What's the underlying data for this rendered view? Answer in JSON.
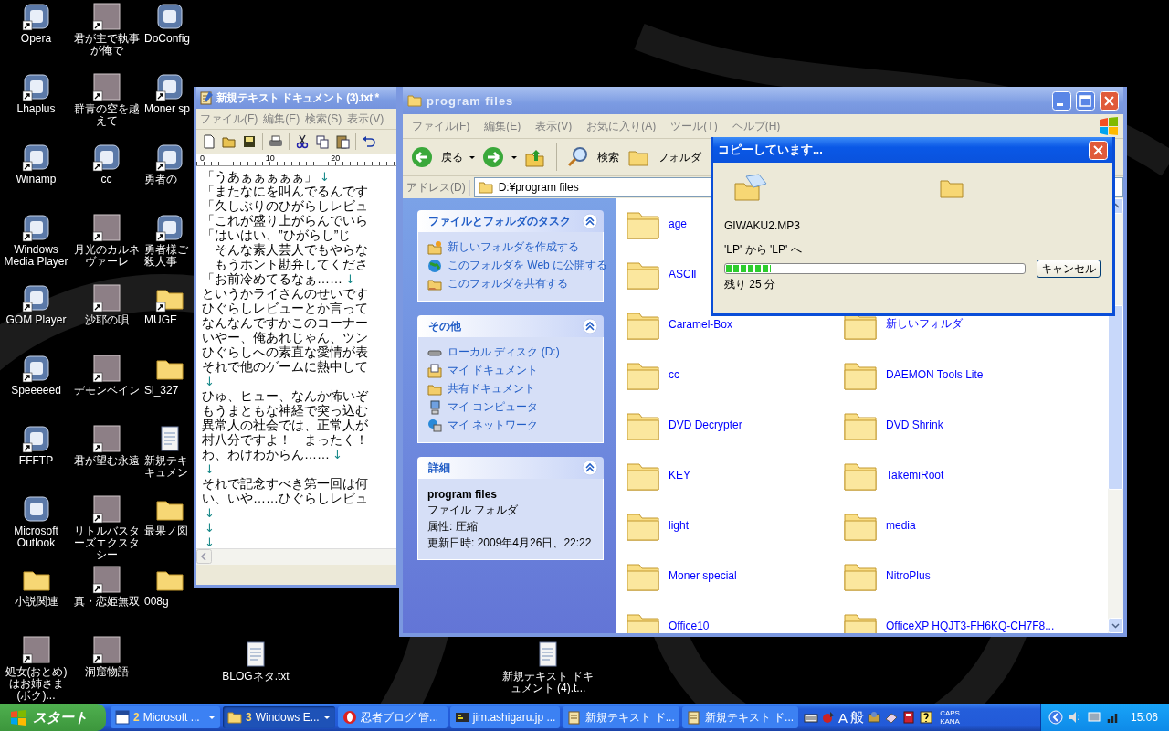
{
  "desktop_icons": [
    {
      "label": "Opera",
      "kind": "app",
      "shortcut": true
    },
    {
      "label": "Lhaplus",
      "kind": "app",
      "shortcut": true
    },
    {
      "label": "Winamp",
      "kind": "app",
      "shortcut": true
    },
    {
      "label": "Windows\nMedia Player",
      "kind": "app",
      "shortcut": true
    },
    {
      "label": "GOM Player",
      "kind": "app",
      "shortcut": true
    },
    {
      "label": "Speeeeed",
      "kind": "app",
      "shortcut": true
    },
    {
      "label": "FFFTP",
      "kind": "app",
      "shortcut": true
    },
    {
      "label": "Microsoft\nOutlook",
      "kind": "app",
      "shortcut": false
    },
    {
      "label": "小説関連",
      "kind": "folder",
      "shortcut": false
    },
    {
      "label": "処女(おとめ)はお姉さま(ボク)...",
      "kind": "picture",
      "shortcut": true
    },
    {
      "label": "君が主で執事が俺で",
      "kind": "picture",
      "shortcut": true
    },
    {
      "label": "群青の空を越えて",
      "kind": "picture",
      "shortcut": true
    },
    {
      "label": "cc",
      "kind": "app",
      "shortcut": true
    },
    {
      "label": "月光のカルネヴァーレ",
      "kind": "picture",
      "shortcut": true
    },
    {
      "label": "沙耶の唄",
      "kind": "picture",
      "shortcut": true
    },
    {
      "label": "デモンベイン",
      "kind": "picture",
      "shortcut": true
    },
    {
      "label": "君が望む永遠",
      "kind": "picture",
      "shortcut": true
    },
    {
      "label": "リトルバスターズエクスタシー",
      "kind": "picture",
      "shortcut": true
    },
    {
      "label": "真・恋姫無双",
      "kind": "picture",
      "shortcut": true
    },
    {
      "label": "洞窟物語",
      "kind": "picture",
      "shortcut": true
    },
    {
      "label": "DoConfig",
      "kind": "app",
      "shortcut": false
    },
    {
      "label": "Moner sp",
      "kind": "app",
      "shortcut": true
    },
    {
      "label": "勇者の",
      "kind": "app",
      "shortcut": true
    },
    {
      "label": "勇者様ご殺人事",
      "kind": "app",
      "shortcut": true
    },
    {
      "label": "MUGE",
      "kind": "folder",
      "shortcut": true
    },
    {
      "label": "Si_327",
      "kind": "folder",
      "shortcut": false
    },
    {
      "label": "新規テキキュメン",
      "kind": "document",
      "shortcut": false
    },
    {
      "label": "最果ノ図",
      "kind": "folder",
      "shortcut": false
    },
    {
      "label": "008g",
      "kind": "folder",
      "shortcut": false
    }
  ],
  "loose_icons": [
    {
      "label": "BLOGネタ.txt",
      "kind": "document",
      "shortcut": false
    },
    {
      "label": "新規テキスト ドキュメント (4).t...",
      "kind": "document",
      "shortcut": false
    }
  ],
  "notepad": {
    "title": "新規テキスト ドキュメント (3).txt *",
    "menu": [
      "ファイル(F)",
      "編集(E)",
      "検索(S)",
      "表示(V)"
    ],
    "ruler": [
      "0",
      "10",
      "20"
    ],
    "lines": [
      {
        "text": "「うあぁぁぁぁぁ」",
        "eol": "↓"
      },
      {
        "text": "「またなにを叫んでるんです"
      },
      {
        "text": "「久しぶりのひがらしレビュ"
      },
      {
        "text": "「これが盛り上がらんでいら"
      },
      {
        "text": "「はいはい、”ひがらし”じ"
      },
      {
        "text": "　そんな素人芸人でもやらな"
      },
      {
        "text": "　もうホント勘弁してくださ"
      },
      {
        "text": "「お前冷めてるなぁ……",
        "eol": "↓"
      },
      {
        "text": "というかライさんのせいです"
      },
      {
        "text": "ひぐらしレビューとか言って"
      },
      {
        "text": "なんなんですかこのコーナー"
      },
      {
        "text": "いやー、俺あれじゃん、ツン"
      },
      {
        "text": "ひぐらしへの素直な愛情が表"
      },
      {
        "text": "それで他のゲームに熱中して"
      },
      {
        "eol": "↓"
      },
      {
        "text": "ひゅ、ヒュー、なんか怖いぞ"
      },
      {
        "text": "もうまともな神経で突っ込む"
      },
      {
        "text": "異常人の社会では、正常人が"
      },
      {
        "text": "村八分ですよ！　まったく！"
      },
      {
        "text": "わ、わけわからん……",
        "eol": "↓"
      },
      {
        "eol": "↓"
      },
      {
        "text": "それで記念すべき第一回は何"
      },
      {
        "text": "い、いや……ひぐらしレビュ"
      },
      {
        "eol": "↓"
      },
      {
        "eol": "↓"
      },
      {
        "eol": "↓"
      }
    ]
  },
  "explorer": {
    "title": "program files",
    "menu": [
      "ファイル(F)",
      "編集(E)",
      "表示(V)",
      "お気に入り(A)",
      "ツール(T)",
      "ヘルプ(H)"
    ],
    "toolbar": {
      "back": "戻る",
      "search": "検索",
      "folders": "フォルダ"
    },
    "address_label": "アドレス(D)",
    "address": "D:¥program files",
    "panels": [
      {
        "title": "ファイルとフォルダのタスク",
        "expanded": true,
        "kind": "links",
        "items": [
          {
            "label": "新しいフォルダを作成する",
            "kind": "new-folder"
          },
          {
            "label": "このフォルダを Web に公開する",
            "kind": "globe"
          },
          {
            "label": "このフォルダを共有する",
            "kind": "shared-folder"
          }
        ]
      },
      {
        "title": "その他",
        "expanded": true,
        "kind": "links",
        "items": [
          {
            "label": "ローカル ディスク (D:)",
            "kind": "disk"
          },
          {
            "label": "マイ ドキュメント",
            "kind": "documents"
          },
          {
            "label": "共有ドキュメント",
            "kind": "folder"
          },
          {
            "label": "マイ コンピュータ",
            "kind": "computer"
          },
          {
            "label": "マイ ネットワーク",
            "kind": "network"
          }
        ]
      },
      {
        "title": "詳細",
        "expanded": true,
        "kind": "details",
        "name": "program files",
        "lines": [
          "ファイル フォルダ",
          "属性: 圧縮",
          "更新日時: 2009年4月26日、22:22"
        ]
      }
    ],
    "files": {
      "column_1": [
        "age",
        "ASCⅡ",
        "Caramel-Box",
        "cc",
        "DVD Decrypter",
        "KEY",
        "light",
        "Moner special",
        "Office10"
      ],
      "column_2": [
        "新しいフォルダ",
        "DAEMON Tools Lite",
        "DVD Shrink",
        "TakemiRoot",
        "media",
        "NitroPlus",
        "OfficeXP HQJT3-FH6KQ-CH7F8..."
      ]
    }
  },
  "copy_dialog": {
    "title": "コピーしています...",
    "file": "GIWAKU2.MP3",
    "route": "'LP' から 'LP' へ",
    "progress": {
      "level": 0.15
    },
    "remaining": "残り 25 分",
    "cancel": "キャンセル"
  },
  "taskbar": {
    "start": "スタート",
    "tasks": [
      {
        "count": "2",
        "label": "Microsoft ...",
        "kind": "word",
        "group": true,
        "selected": false
      },
      {
        "count": "3",
        "label": "Windows E...",
        "kind": "folder",
        "group": true,
        "selected": true
      },
      {
        "label": "忍者ブログ 管...",
        "kind": "browser",
        "group": false,
        "selected": false
      },
      {
        "label": "jim.ashigaru.jp ...",
        "kind": "ftp",
        "group": false,
        "selected": false
      },
      {
        "label": "新規テキスト ド...",
        "kind": "notepad",
        "group": false,
        "selected": false
      },
      {
        "label": "新規テキスト ド...",
        "kind": "notepad",
        "group": false,
        "selected": false
      }
    ],
    "ime": [
      "A",
      "般"
    ],
    "caps": "CAPS",
    "kana": "KANA",
    "clock": "15:06"
  }
}
